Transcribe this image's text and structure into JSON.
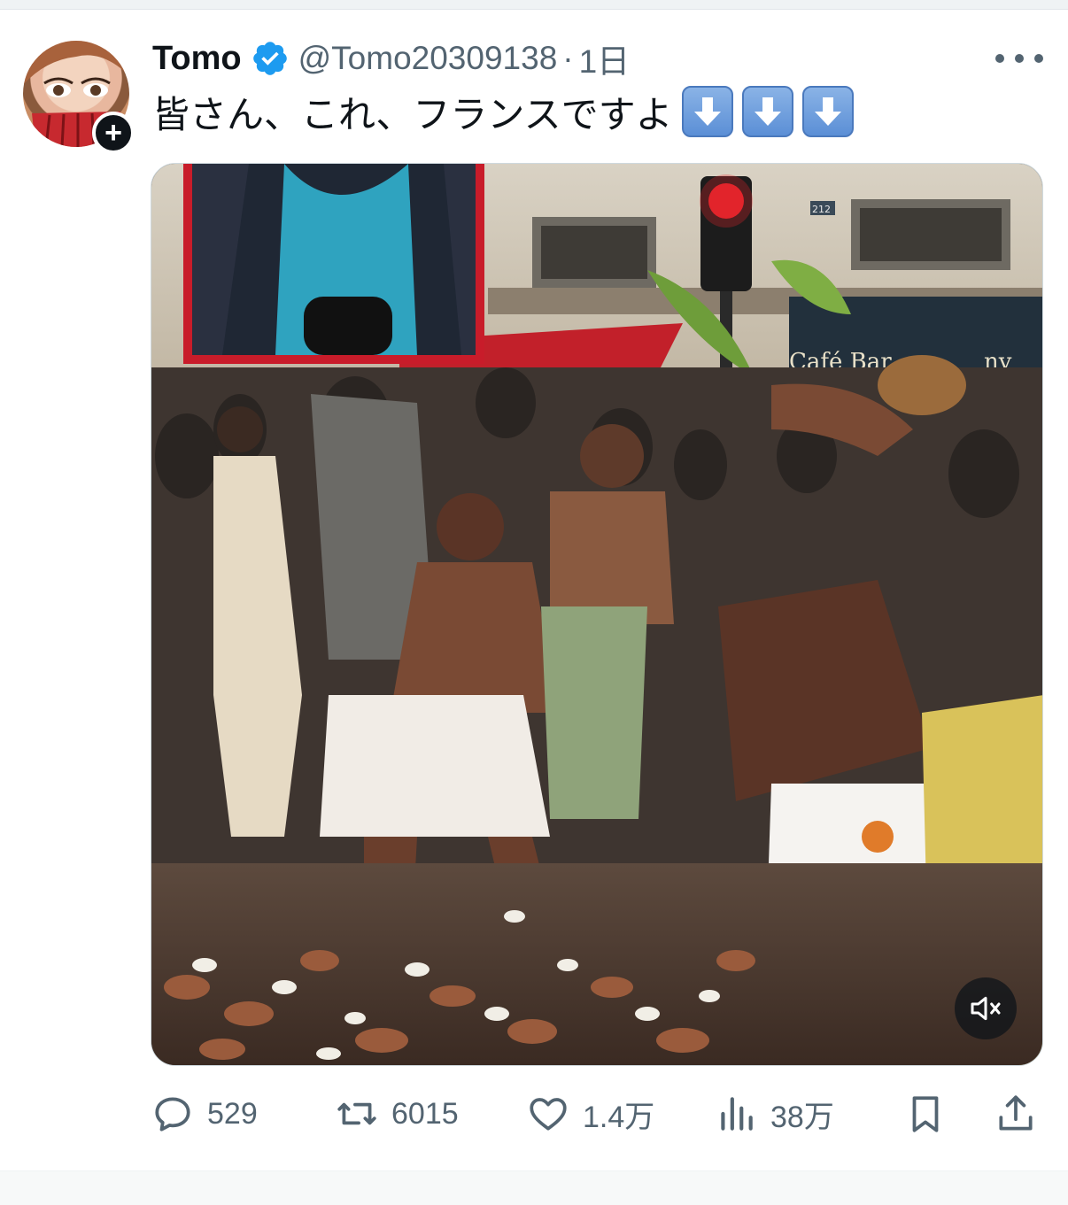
{
  "tweet": {
    "display_name": "Tomo",
    "handle": "@Tomo20309138",
    "separator": "·",
    "time": "1日",
    "text": "皆さん、これ、フランスですよ",
    "emoji": [
      "down-arrow",
      "down-arrow",
      "down-arrow"
    ],
    "verified": true
  },
  "media": {
    "scene_sign_text": "Café Bar",
    "scene_sign_text_2": "ny",
    "street_number": "212",
    "muted": true
  },
  "actions": {
    "replies": "529",
    "reposts": "6015",
    "likes": "1.4万",
    "views": "38万"
  },
  "colors": {
    "text_primary": "#0f1419",
    "text_secondary": "#536471",
    "verified_blue": "#1d9bf0",
    "divider": "#eff3f4"
  }
}
